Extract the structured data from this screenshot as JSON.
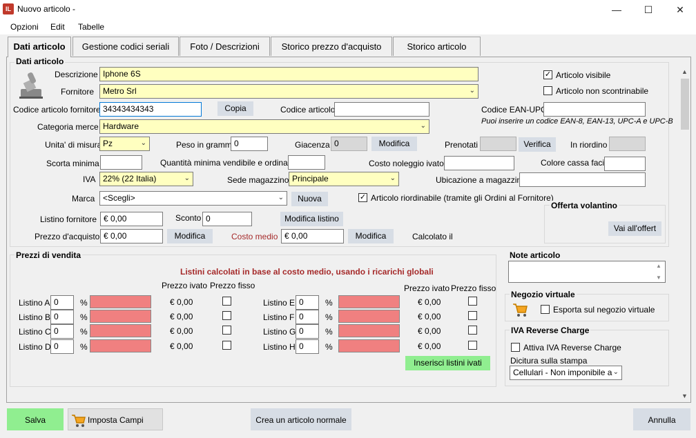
{
  "window": {
    "title": "Nuovo articolo -",
    "app_icon": "IL"
  },
  "menu": {
    "items": [
      "Opzioni",
      "Edit",
      "Tabelle"
    ]
  },
  "tabs": [
    "Dati articolo",
    "Gestione codici seriali",
    "Foto / Descrizioni",
    "Storico prezzo d'acquisto",
    "Storico articolo"
  ],
  "dati": {
    "section_title": "Dati articolo",
    "descrizione_label": "Descrizione",
    "descrizione_value": "Iphone 6S",
    "fornitore_label": "Fornitore",
    "fornitore_value": "Metro Srl",
    "codforn_label": "Codice articolo fornitore",
    "codforn_value": "34343434343",
    "copia_label": "Copia",
    "codart_label": "Codice articolo",
    "codart_value": "",
    "ean_label": "Codice EAN-UPC",
    "ean_value": "",
    "ean_hint": "Puoi inserire un codice EAN-8, EAN-13, UPC-A e UPC-B",
    "visibile_label": "Articolo visibile",
    "visibile_checked": true,
    "nonscontr_label": "Articolo non scontrinabile",
    "nonscontr_checked": false,
    "categoria_label": "Categoria merce",
    "categoria_value": "Hardware",
    "um_label": "Unita' di misura",
    "um_value": "Pz",
    "peso_label": "Peso in grammi",
    "peso_value": "0",
    "giacenza_label": "Giacenza",
    "giacenza_value": "0",
    "modifica_label": "Modifica",
    "prenotati_label": "Prenotati",
    "prenotati_value": "",
    "verifica_label": "Verifica",
    "riordino_label": "In riordino",
    "riordino_value": "",
    "scorta_label": "Scorta minima",
    "scorta_value": "",
    "qmin_label": "Quantità minima vendibile e ordinabile",
    "qmin_value": "",
    "noleggio_label": "Costo noleggio ivato",
    "noleggio_value": "",
    "colore_label": "Colore cassa facile",
    "colore_value": "",
    "iva_label": "IVA",
    "iva_value": "22% (22 Italia)",
    "sede_label": "Sede magazzino",
    "sede_value": "Principale",
    "ubicazione_label": "Ubicazione a magazzino",
    "ubicazione_value": "",
    "marca_label": "Marca",
    "marca_value": "<Scegli>",
    "nuova_label": "Nuova",
    "riordinabile_label": "Articolo riordinabile (tramite gli Ordini al Fornitore)",
    "riordinabile_checked": true,
    "listino_label": "Listino fornitore",
    "listino_value": "€ 0,00",
    "sconto_label": "Sconto",
    "sconto_value": "0",
    "modlistino_label": "Modifica listino",
    "acquisto_label": "Prezzo d'acquisto",
    "acquisto_value": "€ 0,00",
    "costomedio_label": "Costo medio",
    "costomedio_value": "€ 0,00",
    "calcolato_label": "Calcolato il",
    "offerta_title": "Offerta volantino",
    "offerta_btn": "Vai all'offert"
  },
  "prezzi": {
    "title": "Prezzi di vendita",
    "note": "Listini calcolati in base al costo medio, usando i ricarichi globali",
    "col_ivato": "Prezzo ivato",
    "col_fisso": "Prezzo fisso",
    "left": [
      {
        "label": "Listino A",
        "pct": "0",
        "ivato": "€ 0,00"
      },
      {
        "label": "Listino B",
        "pct": "0",
        "ivato": "€ 0,00"
      },
      {
        "label": "Listino C",
        "pct": "0",
        "ivato": "€ 0,00"
      },
      {
        "label": "Listino D",
        "pct": "0",
        "ivato": "€ 0,00"
      }
    ],
    "right": [
      {
        "label": "Listino E",
        "pct": "0",
        "ivato": "€ 0,00"
      },
      {
        "label": "Listino F",
        "pct": "0",
        "ivato": "€ 0,00"
      },
      {
        "label": "Listino G",
        "pct": "0",
        "ivato": "€ 0,00"
      },
      {
        "label": "Listino H",
        "pct": "0",
        "ivato": "€ 0,00"
      }
    ],
    "pct_symbol": "%",
    "inserisci_label": "Inserisci listini ivati"
  },
  "note": {
    "title": "Note articolo",
    "value": ""
  },
  "negozio": {
    "title": "Negozio virtuale",
    "esporta_label": "Esporta sul negozio virtuale"
  },
  "reverse": {
    "title": "IVA Reverse Charge",
    "attiva_label": "Attiva IVA Reverse Charge",
    "dicitura_label": "Dicitura sulla stampa",
    "dicitura_value": "Cellulari - Non imponibile a"
  },
  "footer": {
    "salva": "Salva",
    "campi_web": "Imposta Campi Web",
    "crea": "Crea un articolo normale",
    "annulla": "Annulla"
  },
  "colors": {
    "yellow": "#ffffc0",
    "red": "#f08080",
    "green": "#90ee90",
    "button": "#d7dde5",
    "costomedio": "#a52a2a",
    "accent_note": "#a52a2a"
  }
}
